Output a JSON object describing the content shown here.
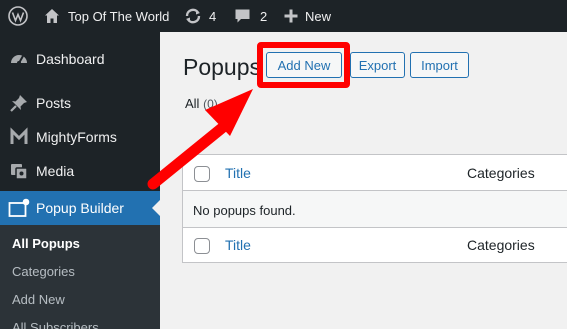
{
  "adminbar": {
    "site_name": "Top Of The World",
    "updates_count": "4",
    "comments_count": "2",
    "new_label": "New"
  },
  "sidebar": {
    "items": [
      {
        "label": "Dashboard",
        "icon": "dashboard-icon"
      },
      {
        "label": "Posts",
        "icon": "pin-icon"
      },
      {
        "label": "MightyForms",
        "icon": "mightyforms-icon"
      },
      {
        "label": "Media",
        "icon": "media-icon"
      },
      {
        "label": "Popup Builder",
        "icon": "popup-builder-icon"
      }
    ],
    "submenu": [
      "All Popups",
      "Categories",
      "Add New",
      "All Subscribers"
    ]
  },
  "main": {
    "title": "Popups",
    "buttons": {
      "add_new": "Add New",
      "export": "Export",
      "import": "Import"
    },
    "filter": {
      "label": "All",
      "count": "(0)"
    },
    "table": {
      "col_title": "Title",
      "col_categories": "Categories",
      "empty": "No popups found."
    }
  },
  "annotation_color": "#ff0000"
}
